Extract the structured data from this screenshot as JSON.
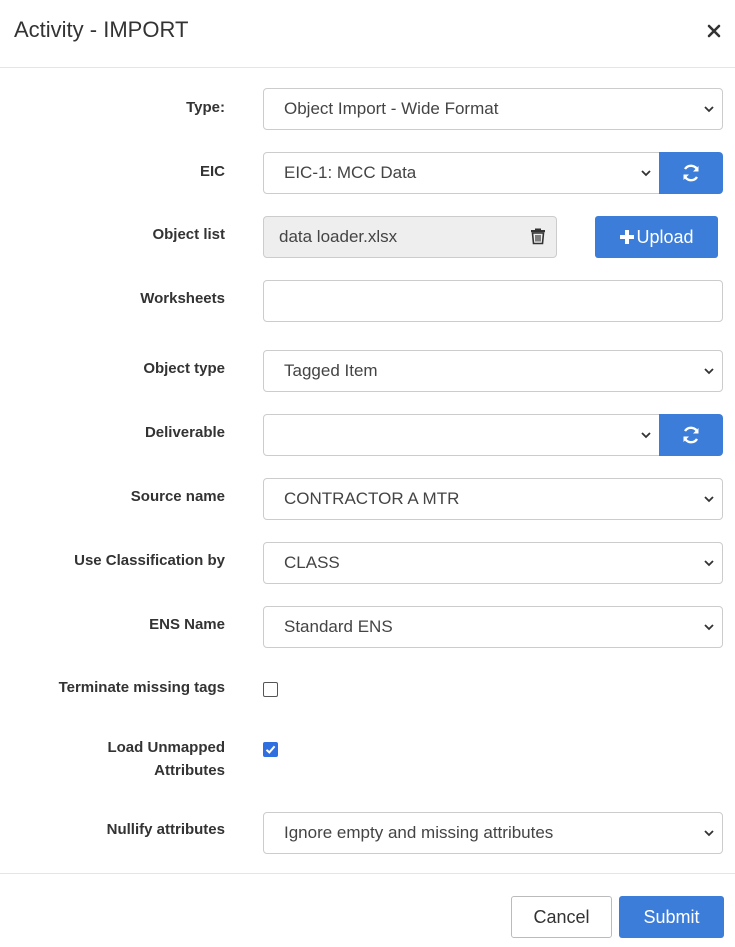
{
  "dialog": {
    "title": "Activity - IMPORT",
    "close_icon": "close-icon"
  },
  "form": {
    "type": {
      "label": "Type:",
      "value": "Object Import - Wide Format"
    },
    "eic": {
      "label": "EIC",
      "value": "EIC-1: MCC Data",
      "refresh_icon": "refresh-icon"
    },
    "object_list": {
      "label": "Object list",
      "file_name": "data loader.xlsx",
      "delete_icon": "trash-icon",
      "upload_label": "Upload",
      "upload_icon": "plus-icon"
    },
    "worksheets": {
      "label": "Worksheets",
      "value": ""
    },
    "object_type": {
      "label": "Object type",
      "value": "Tagged Item"
    },
    "deliverable": {
      "label": "Deliverable",
      "value": "",
      "refresh_icon": "refresh-icon"
    },
    "source_name": {
      "label": "Source name",
      "value": "CONTRACTOR A MTR"
    },
    "use_classification_by": {
      "label": "Use Classification by",
      "value": "CLASS"
    },
    "ens_name": {
      "label": "ENS Name",
      "value": "Standard ENS"
    },
    "terminate_missing_tags": {
      "label": "Terminate missing tags",
      "checked": false
    },
    "load_unmapped_attributes": {
      "label_line1": "Load Unmapped",
      "label_line2": "Attributes",
      "checked": true
    },
    "nullify_attributes": {
      "label": "Nullify attributes",
      "value": "Ignore empty and missing attributes"
    }
  },
  "footer": {
    "cancel_label": "Cancel",
    "submit_label": "Submit"
  },
  "colors": {
    "primary": "#3b7dd8",
    "checkbox_checked": "#2f6fe0",
    "readonly_bg": "#eeeeee",
    "border": "#cccccc"
  }
}
